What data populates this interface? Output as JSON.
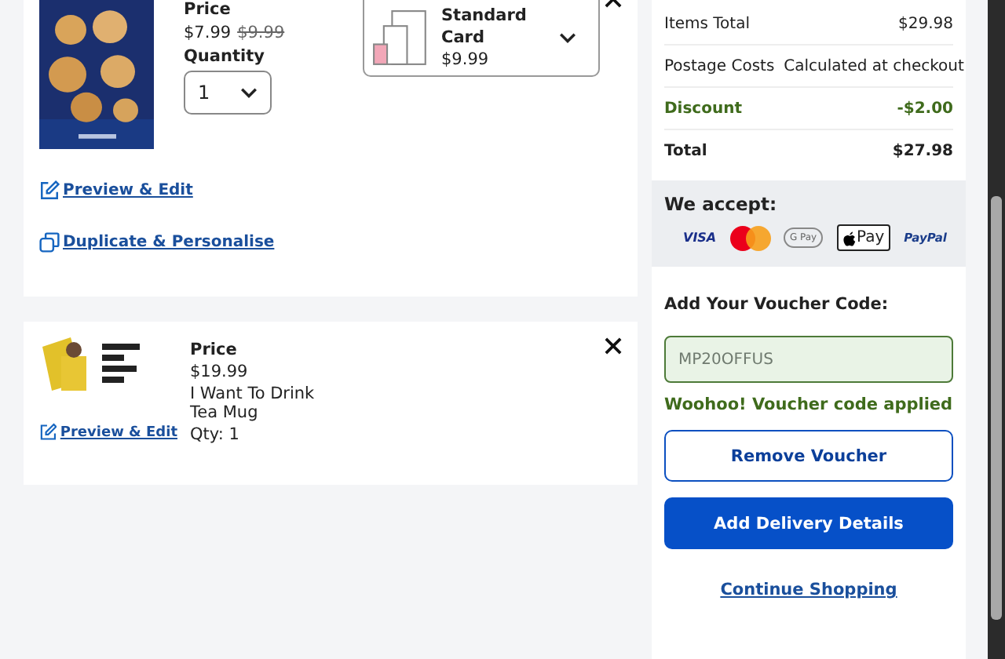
{
  "cart_items": [
    {
      "kind": "card",
      "price_label": "Price",
      "price": "$7.99",
      "was_price": "$9.99",
      "quantity_label": "Quantity",
      "quantity": "1",
      "option": {
        "name": "Standard Card",
        "price": "$9.99"
      },
      "links": [
        {
          "kind": "edit",
          "label": "Preview & Edit"
        },
        {
          "kind": "duplicate",
          "label": "Duplicate & Personalise"
        }
      ]
    },
    {
      "kind": "mug",
      "price_label": "Price",
      "price": "$19.99",
      "name": "I Want To Drink Tea Mug",
      "qty": "Qty: 1",
      "links": [
        {
          "kind": "edit",
          "label": "Preview & Edit"
        }
      ]
    }
  ],
  "summary": {
    "rows": [
      {
        "kind": "normal",
        "label": "Items Total",
        "value": "$29.98"
      },
      {
        "kind": "normal",
        "label": "Postage Costs",
        "value": "Calculated at checkout"
      },
      {
        "kind": "discount",
        "label": "Discount",
        "value": "-$2.00"
      },
      {
        "kind": "total",
        "label": "Total",
        "value": "$27.98"
      }
    ]
  },
  "payments": {
    "title": "We accept:",
    "methods": [
      {
        "kind": "visa",
        "label": "VISA"
      },
      {
        "kind": "mastercard"
      },
      {
        "kind": "gpay",
        "label": "G Pay"
      },
      {
        "kind": "applepay",
        "label": "Pay"
      },
      {
        "kind": "paypal",
        "label": "PayPal"
      }
    ]
  },
  "voucher": {
    "title": "Add Your Voucher Code:",
    "value": "MP20OFFUS",
    "applied": true,
    "message": "Woohoo! Voucher code applied"
  },
  "buttons": [
    {
      "kind": "outline",
      "label": "Remove Voucher"
    },
    {
      "kind": "primary",
      "label": "Add Delivery Details"
    },
    {
      "kind": "link",
      "label": "Continue Shopping"
    }
  ]
}
